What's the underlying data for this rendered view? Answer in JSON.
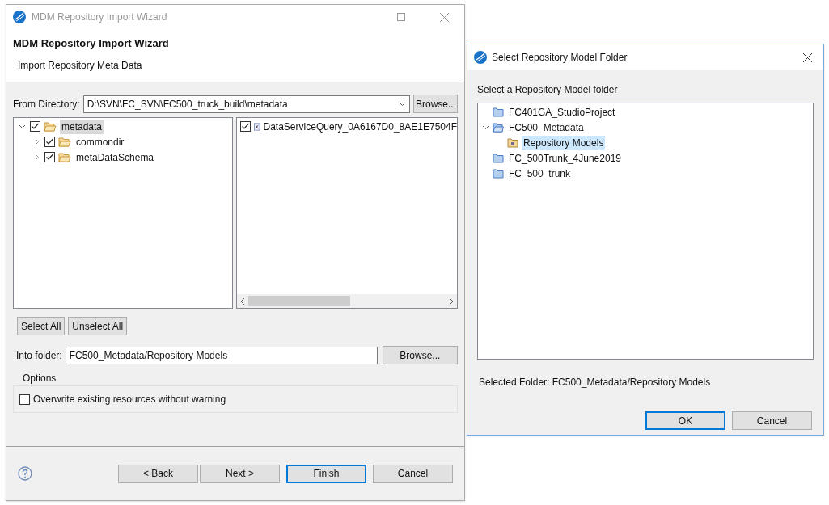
{
  "wizard": {
    "title": "MDM Repository Import Wizard",
    "heading": "MDM Repository Import Wizard",
    "subheading": "Import Repository Meta Data",
    "from_directory": {
      "label": "From Directory:",
      "value": "D:\\SVN\\FC_SVN\\FC500_truck_build\\metadata",
      "browse": "Browse..."
    },
    "folder_tree": [
      {
        "label": "metadata",
        "checked": true,
        "expanded": true,
        "selected": true,
        "children": [
          {
            "label": "commondir",
            "checked": true,
            "expanded": false,
            "selected": false
          },
          {
            "label": "metaDataSchema",
            "checked": true,
            "expanded": false,
            "selected": false
          }
        ]
      }
    ],
    "files": [
      {
        "label": "DataServiceQuery_0A6167D0_8AE1E7504F",
        "checked": true
      }
    ],
    "select_buttons": [
      "Select All",
      "Unselect All"
    ],
    "into_folder": {
      "label": "Into folder:",
      "value": "FC500_Metadata/Repository Models",
      "browse": "Browse..."
    },
    "options": {
      "title": "Options",
      "items": [
        {
          "label": "Overwrite existing resources without warning",
          "checked": false
        }
      ]
    },
    "buttons": [
      {
        "label": "< Back",
        "default": false
      },
      {
        "label": "Next >",
        "default": false
      },
      {
        "label": "Finish",
        "default": true
      },
      {
        "label": "Cancel",
        "default": false
      }
    ]
  },
  "folder_dialog": {
    "title": "Select Repository Model Folder",
    "prompt": "Select a Repository Model folder",
    "tree": [
      {
        "label": "FC401GA_StudioProject",
        "kind": "project",
        "selected": false
      },
      {
        "label": "FC500_Metadata",
        "kind": "open-project",
        "expanded": true,
        "selected": false,
        "children": [
          {
            "label": "Repository Models",
            "kind": "folder",
            "selected": true
          }
        ]
      },
      {
        "label": "FC_500Trunk_4June2019",
        "kind": "project",
        "selected": false
      },
      {
        "label": "FC_500_trunk",
        "kind": "project",
        "selected": false
      }
    ],
    "selected_folder": "Selected Folder: FC500_Metadata/Repository Models",
    "buttons": [
      {
        "label": "OK",
        "default": true
      },
      {
        "label": "Cancel",
        "default": false
      }
    ]
  }
}
